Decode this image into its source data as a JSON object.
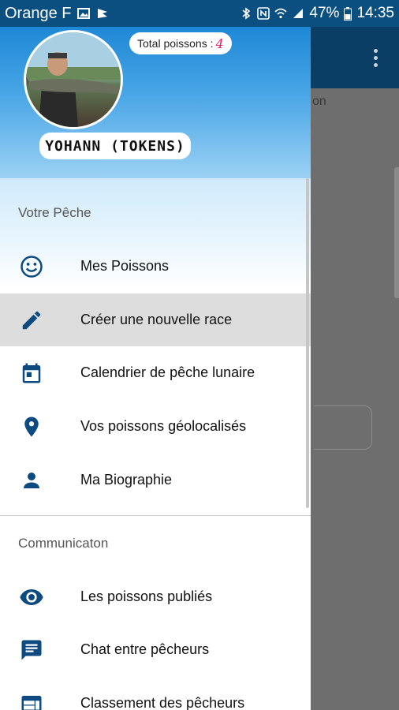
{
  "status_bar": {
    "carrier": "Orange F",
    "battery": "47%",
    "time": "14:35"
  },
  "drawer": {
    "header": {
      "total_label": "Total poissons :",
      "total_count": "4",
      "username": "YOHANN (TOKENS)"
    },
    "sections": [
      {
        "title": "Votre Pêche",
        "items": [
          {
            "label": "Mes Poissons",
            "icon": "smiley-icon"
          },
          {
            "label": "Créer une nouvelle race",
            "icon": "pencil-icon"
          },
          {
            "label": "Calendrier de pêche lunaire",
            "icon": "calendar-icon"
          },
          {
            "label": "Vos poissons géolocalisés",
            "icon": "location-pin-icon"
          },
          {
            "label": "Ma Biographie",
            "icon": "person-icon"
          }
        ]
      },
      {
        "title": "Communicaton",
        "items": [
          {
            "label": "Les poissons publiés",
            "icon": "eye-icon"
          },
          {
            "label": "Chat entre pêcheurs",
            "icon": "chat-icon"
          },
          {
            "label": "Classement des pêcheurs",
            "icon": "web-panel-icon"
          }
        ]
      }
    ],
    "selected_index": 1,
    "colors": {
      "accent": "#0b4f80",
      "icon": "#0d4a7f",
      "badge_count": "#e0206a"
    }
  },
  "background_app": {
    "partial_text": "on"
  }
}
